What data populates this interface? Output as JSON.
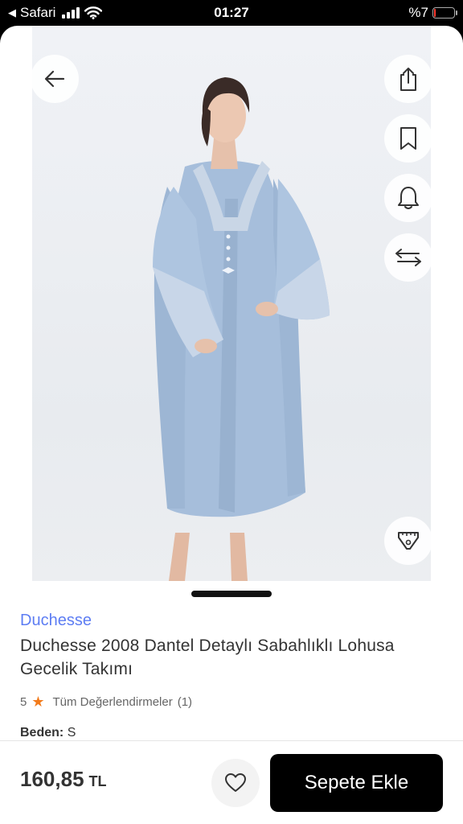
{
  "status_bar": {
    "back_arrow": "◀",
    "carrier": "Safari",
    "time": "01:27",
    "battery_text": "%7",
    "battery_level_percent": 7
  },
  "icons": {
    "back": "arrow-left-icon",
    "share": "share-icon",
    "bookmark": "bookmark-icon",
    "alert": "bell-icon",
    "compare": "compare-arrows-icon",
    "size_guide": "tape-measure-icon",
    "favorite": "heart-icon"
  },
  "product": {
    "brand": "Duchesse",
    "title": "Duchesse 2008 Dantel Detaylı Sabahlıklı Lohusa Gecelik Takımı",
    "rating_value": "5",
    "rating_star": "★",
    "reviews_label": "Tüm Değerlendirmeler",
    "reviews_count": "(1)",
    "size_label": "Beden:",
    "size_value": "S"
  },
  "purchase": {
    "price": "160,85",
    "currency": "TL",
    "add_to_cart_label": "Sepete Ekle"
  },
  "colors": {
    "brand_link": "#5d7df3",
    "star": "#f27a1a",
    "cart_button": "#000000",
    "garment": "#a6bedb"
  }
}
